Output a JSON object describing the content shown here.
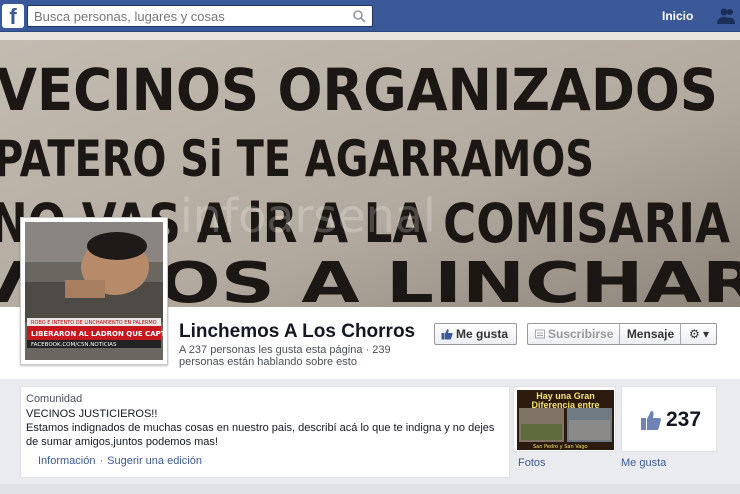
{
  "topbar": {
    "logo": "f",
    "search_placeholder": "Busca personas, lugares y cosas",
    "home_label": "Inicio"
  },
  "cover": {
    "sign_lines": [
      "VECINOS ORGANIZADOS",
      "PATERO Si TE AGARRAMOS",
      "NO VAS A iR A LA COMISARIA",
      "VAMOS A LINCHAR"
    ],
    "watermark": "infoarsenal"
  },
  "profile": {
    "name": "Linchemos A Los Chorros",
    "stats": "A 237 personas les gusta esta página · 239 personas están hablando sobre esto",
    "pic_caption": "LIBERARON AL LADRON QUE CAPTURO ROMANO",
    "pic_banner": "ROBO E INTENTO DE LINCHAMIENTO EN PALERMO",
    "pic_footer": "FACEBOOK.COM/C5N.NOTICIAS"
  },
  "actions": {
    "like_label": "Me gusta",
    "subscribe_label": "Suscribirse",
    "message_label": "Mensaje",
    "gear_label": "⚙ ▾"
  },
  "about": {
    "category": "Comunidad",
    "title": "VECINOS JUSTICIEROS!!",
    "description": "Estamos indignados de muchas cosas en nuestro pais, describí acá lo que te indigna y no dejes de sumar amigos,juntos podemos mas!",
    "link_info": "Información",
    "link_separator": "·",
    "link_suggest": "Sugerir una edición"
  },
  "tiles": {
    "photos_caption": "Hay una Gran Diferencia entre",
    "photos_bottom": "San Pedro y San Vago",
    "photos_label": "Fotos",
    "likes_count": "237",
    "likes_label": "Me gusta"
  },
  "colors": {
    "brand": "#3b5998",
    "link": "#3b5998"
  }
}
